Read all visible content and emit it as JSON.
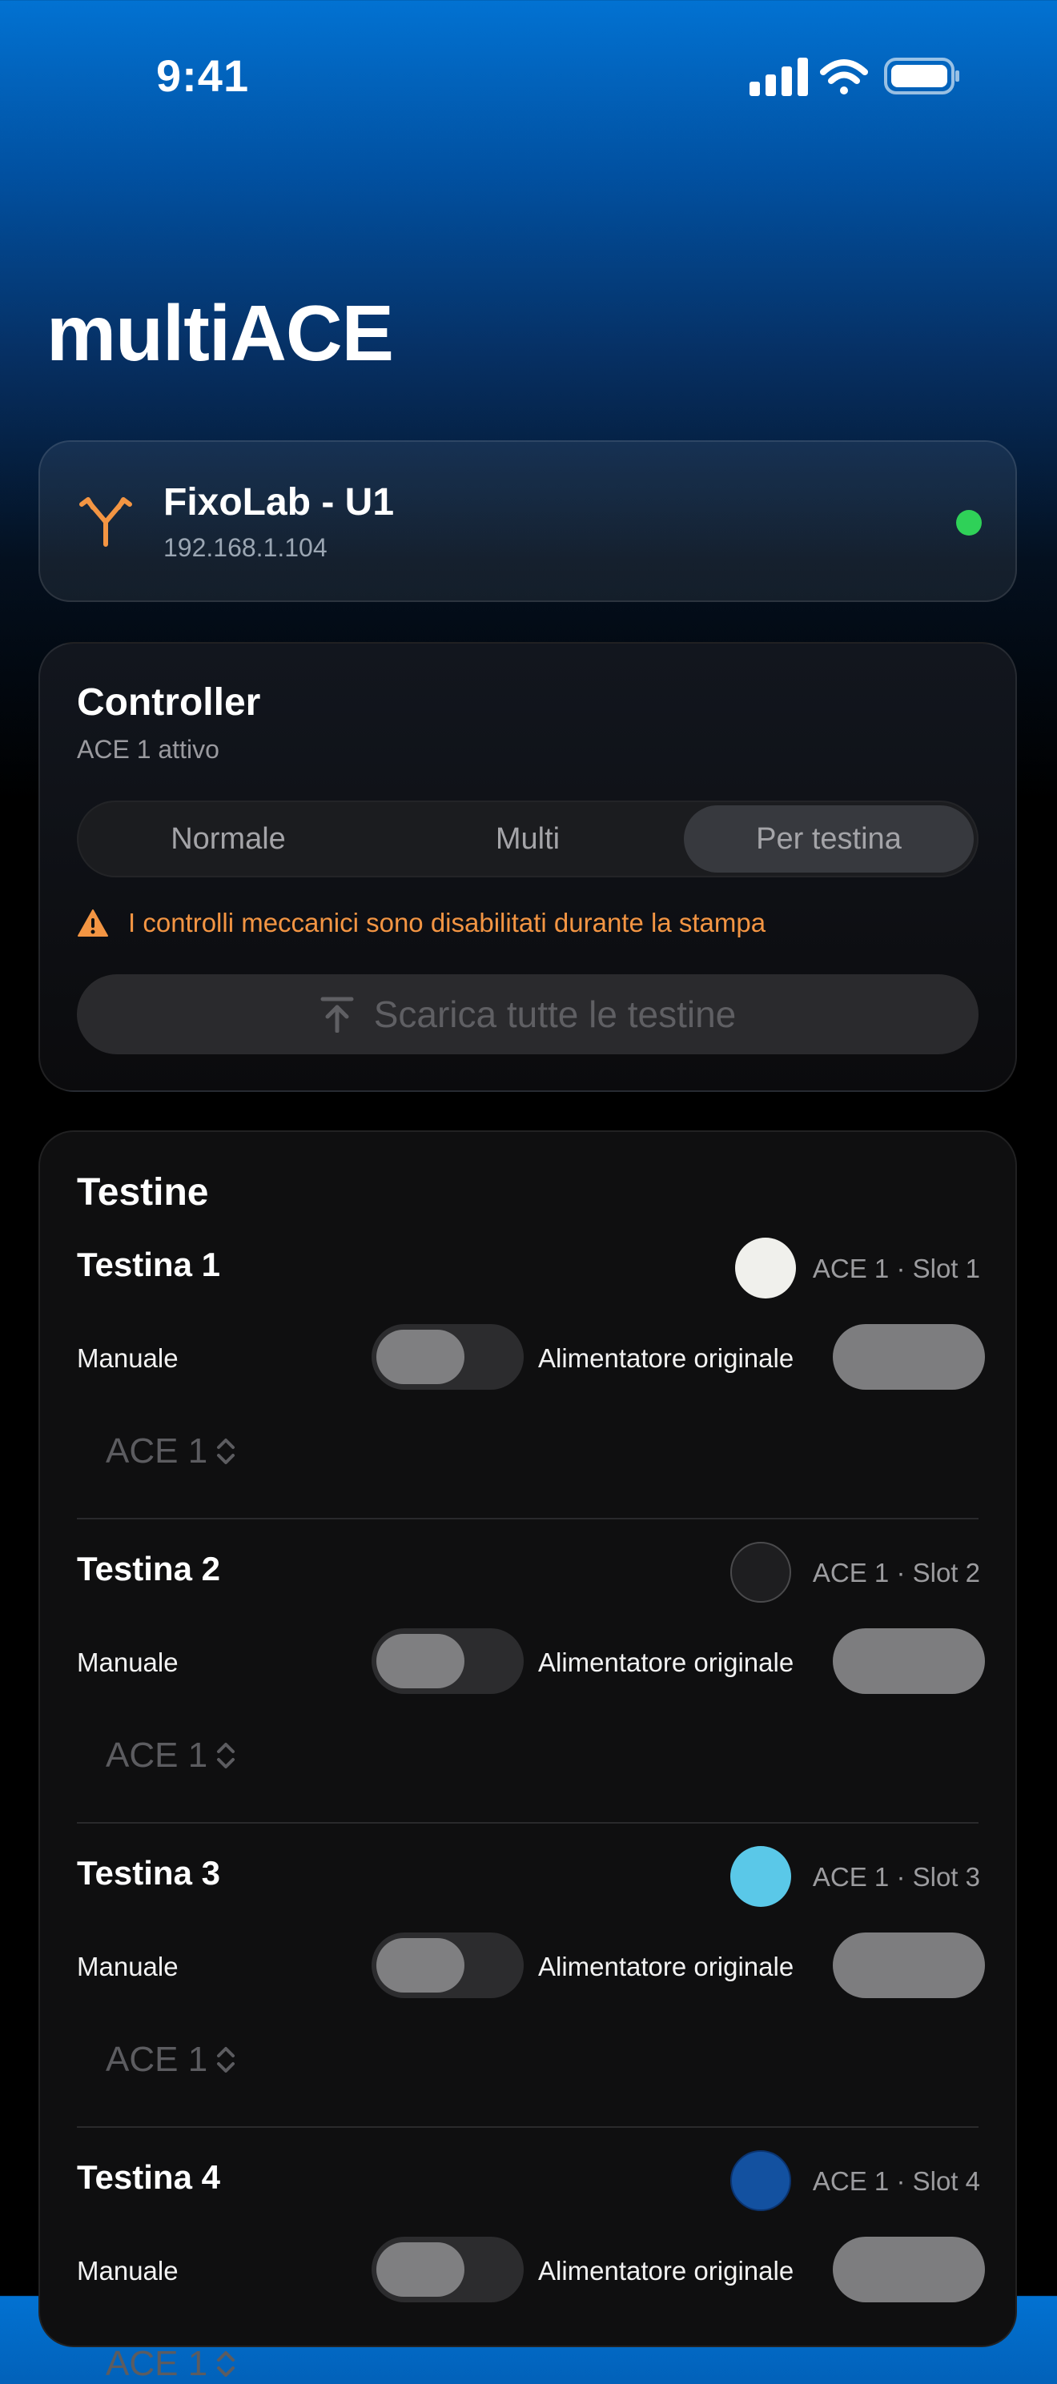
{
  "status_bar": {
    "time": "9:41"
  },
  "app_title": "multiACE",
  "printer": {
    "name": "FixoLab - U1",
    "ip": "192.168.1.104",
    "status_color": "#2fd158",
    "icon": "fork-arrows-icon",
    "accent_color": "#f39543"
  },
  "controller": {
    "title": "Controller",
    "subtitle": "ACE 1 attivo",
    "modes": [
      "Normale",
      "Multi",
      "Per testina"
    ],
    "selected_mode": "Per testina",
    "warning": "I controlli meccanici sono disabilitati durante la stampa",
    "unload_label": "Scarica tutte le testine"
  },
  "heads_section": {
    "title": "Testine",
    "heads": [
      {
        "title": "Testina 1",
        "color": "#f0f0ec",
        "slot": "ACE 1 · Slot 1",
        "manual_label": "Manuale",
        "manual_on": false,
        "feeder_label": "Alimentatore originale",
        "ace": "ACE 1"
      },
      {
        "title": "Testina 2",
        "color": "#1e1e20",
        "slot": "ACE 1 · Slot 2",
        "manual_label": "Manuale",
        "manual_on": false,
        "feeder_label": "Alimentatore originale",
        "ace": "ACE 1"
      },
      {
        "title": "Testina 3",
        "color": "#5ac8e8",
        "slot": "ACE 1 · Slot 3",
        "manual_label": "Manuale",
        "manual_on": false,
        "feeder_label": "Alimentatore originale",
        "ace": "ACE 1"
      },
      {
        "title": "Testina 4",
        "color": "#1351a0",
        "slot": "ACE 1 · Slot 4",
        "manual_label": "Manuale",
        "manual_on": false,
        "feeder_label": "Alimentatore originale",
        "ace": "ACE 1"
      }
    ]
  }
}
